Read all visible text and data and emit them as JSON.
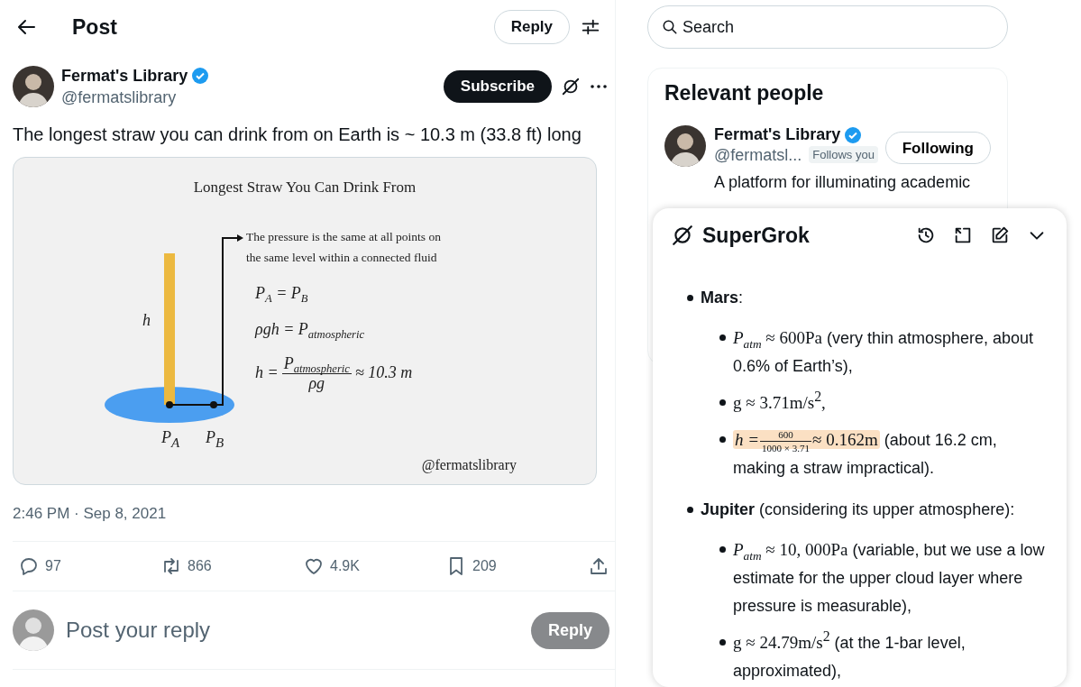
{
  "header": {
    "title": "Post",
    "reply_button": "Reply"
  },
  "post": {
    "author": {
      "name": "Fermat's Library",
      "handle": "@fermatslibrary",
      "verified": true
    },
    "subscribe_button": "Subscribe",
    "text": "The longest straw you can drink from on Earth is ~ 10.3 m (33.8 ft) long",
    "figure": {
      "title": "Longest Straw You Can Drink From",
      "note_lines": [
        "The pressure is the same at all points on",
        "the same level within a connected fluid"
      ],
      "equations": [
        "*P*$_{A}$ = *P*$_{B}$",
        "*ρgh* = *P*$_{atmospheric}$"
      ],
      "fraction": {
        "lhs": "h =",
        "numerator": "*P*$_{atmospheric}$",
        "denominator": "ρg",
        "rhs": "≈ 10.3 m"
      },
      "height_label": "h",
      "point_labels": [
        "*P*$_{A}$",
        "*P*$_{B}$"
      ],
      "credit": "@fermatslibrary"
    },
    "timestamp": "2:46 PM · Sep 8, 2021",
    "stats": [
      {
        "kind": "reply",
        "count": "97"
      },
      {
        "kind": "repost",
        "count": "866"
      },
      {
        "kind": "like",
        "count": "4.9K"
      },
      {
        "kind": "bookmark",
        "count": "209"
      },
      {
        "kind": "share"
      }
    ]
  },
  "composer": {
    "placeholder": "Post your reply",
    "button": "Reply",
    "disabled": true
  },
  "sidebar": {
    "search": {
      "placeholder": "Search"
    },
    "relevant_people": {
      "title": "Relevant people",
      "people": [
        {
          "name": "Fermat's Library",
          "verified": true,
          "handle": "@fermatsl...",
          "follows_you": "Follows you",
          "button": "Following",
          "bio": "A platform for illuminating academic"
        }
      ]
    }
  },
  "grok": {
    "title": "SuperGrok",
    "items": [
      {
        "text": "**Mars**:",
        "children": [
          {
            "kind": "text",
            "math": "*P*$_{atm}$ ≈ 600Pa",
            "text": " (very thin atmosphere, about 0.6% of Earth’s),"
          },
          {
            "kind": "text",
            "math": "g ≈ 3.71m/s$^{2}$,"
          },
          {
            "kind": "fraction",
            "lhs": "h =",
            "numerator": "600",
            "denominator": "1000 × 3.71",
            "rhs": "≈ 0.162m",
            "highlighted": true,
            "text": " (about 16.2 cm, making a straw impractical)."
          }
        ]
      },
      {
        "text": "**Jupiter** (considering its upper atmosphere):",
        "children": [
          {
            "kind": "text",
            "math": "*P*$_{atm}$ ≈ 10, 000Pa",
            "text": " (variable, but we use a low estimate for the upper cloud layer where pressure is measurable),"
          },
          {
            "kind": "text",
            "math": "g ≈ 24.79m/s$^{2}$",
            "text": " (at the 1-bar level, approximated),"
          }
        ]
      }
    ]
  }
}
